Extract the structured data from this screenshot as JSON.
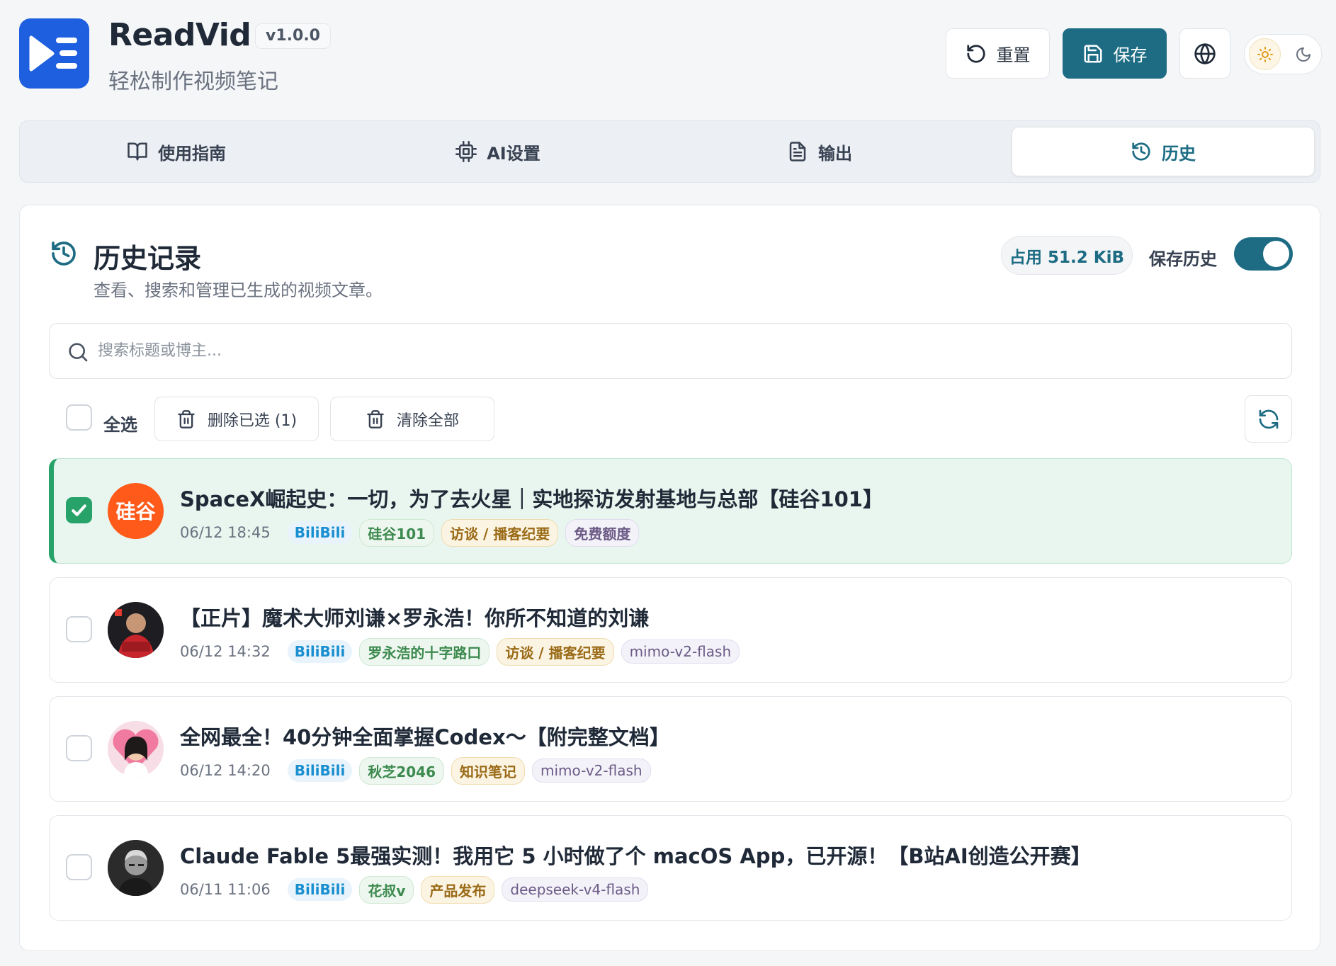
{
  "app": {
    "name": "ReadVid",
    "version": "v1.0.0",
    "subtitle": "轻松制作视频笔记"
  },
  "header": {
    "reset_label": "重置",
    "save_label": "保存"
  },
  "tabs": [
    {
      "label": "使用指南",
      "icon": "book-icon"
    },
    {
      "label": "AI设置",
      "icon": "chip-icon"
    },
    {
      "label": "输出",
      "icon": "document-icon"
    },
    {
      "label": "历史",
      "icon": "history-icon",
      "active": true
    }
  ],
  "history": {
    "title": "历史记录",
    "description": "查看、搜索和管理已生成的视频文章。",
    "usage": "占用 51.2 KiB",
    "save_history_label": "保存历史",
    "save_history_enabled": true,
    "search_placeholder": "搜索标题或博主...",
    "select_all_label": "全选",
    "delete_selected_label": "删除已选 (1)",
    "clear_all_label": "清除全部"
  },
  "items": [
    {
      "title": "SpaceX崛起史：一切，为了去火星｜实地探访发射基地与总部【硅谷101】",
      "date": "06/12 18:45",
      "platform": "BiliBili",
      "author": "硅谷101",
      "category": "访谈 / 播客纪要",
      "model": "免费额度",
      "selected": true,
      "avatar_text": "硅谷"
    },
    {
      "title": "【正片】魔术大师刘谦×罗永浩！你所不知道的刘谦",
      "date": "06/12 14:32",
      "platform": "BiliBili",
      "author": "罗永浩的十字路口",
      "category": "访谈 / 播客纪要",
      "model": "mimo-v2-flash",
      "selected": false
    },
    {
      "title": "全网最全！40分钟全面掌握Codex～【附完整文档】",
      "date": "06/12 14:20",
      "platform": "BiliBili",
      "author": "秋芝2046",
      "category": "知识笔记",
      "model": "mimo-v2-flash",
      "selected": false
    },
    {
      "title": "Claude Fable 5最强实测！我用它 5 小时做了个 macOS App，已开源！【B站AI创造公开赛】",
      "date": "06/11 11:06",
      "platform": "BiliBili",
      "author": "花叔v",
      "category": "产品发布",
      "model": "deepseek-v4-flash",
      "selected": false
    }
  ],
  "colors": {
    "accent": "#1d6c84",
    "logo": "#1e5fe0",
    "selected_green": "#27a36a",
    "selected_bg": "#e8f6ef"
  }
}
